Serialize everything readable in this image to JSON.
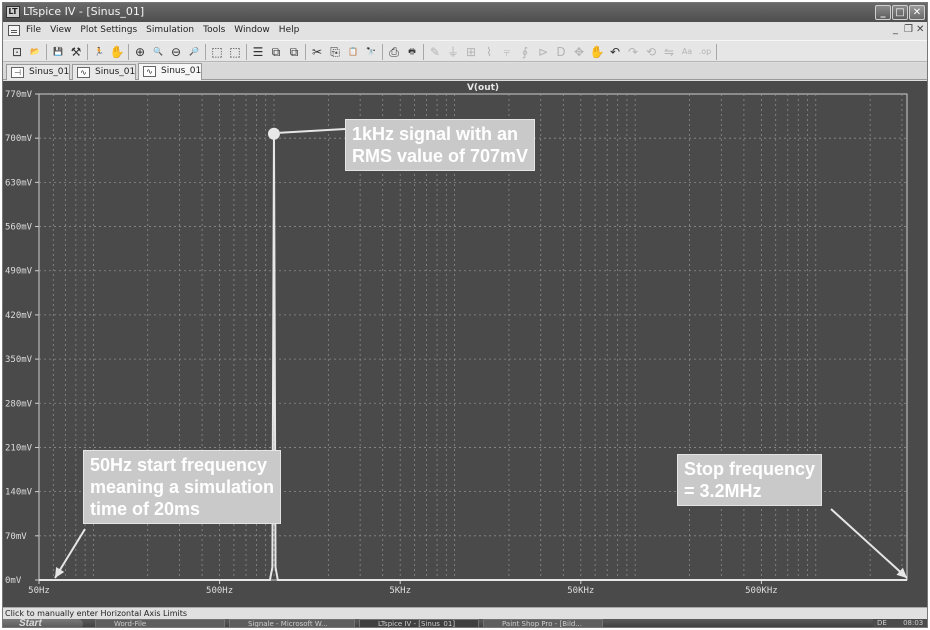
{
  "window": {
    "title": "LTspice IV - [Sinus_01]",
    "app_icon_label": "LT",
    "minimize_glyph": "_",
    "maximize_glyph": "□",
    "close_glyph": "✕",
    "mdi_minimize_glyph": "_",
    "mdi_restore_glyph": "❐",
    "mdi_close_glyph": "✕"
  },
  "menu": {
    "items": [
      "File",
      "View",
      "Plot Settings",
      "Simulation",
      "Tools",
      "Window",
      "Help"
    ]
  },
  "toolbar": {
    "icons": [
      {
        "name": "new-schematic-icon",
        "glyph": "⊡",
        "enabled": true
      },
      {
        "name": "open-file-icon",
        "glyph": "📂",
        "enabled": true
      },
      {
        "name": "save-icon",
        "glyph": "💾",
        "enabled": true
      },
      {
        "name": "control-panel-icon",
        "glyph": "⚒",
        "enabled": true
      },
      {
        "name": "run-icon",
        "glyph": "🏃",
        "enabled": false
      },
      {
        "name": "halt-icon",
        "glyph": "✋",
        "enabled": false
      },
      {
        "name": "zoom-in-icon",
        "glyph": "⊕",
        "enabled": true
      },
      {
        "name": "pan-icon",
        "glyph": "🔍",
        "enabled": true
      },
      {
        "name": "zoom-out-icon",
        "glyph": "⊖",
        "enabled": true
      },
      {
        "name": "zoom-fit-icon",
        "glyph": "🔎",
        "enabled": true
      },
      {
        "name": "autorange-icon",
        "glyph": "⬚",
        "enabled": true
      },
      {
        "name": "plot-settings-icon",
        "glyph": "⬚",
        "enabled": true
      },
      {
        "name": "tile-horizontal-icon",
        "glyph": "☰",
        "enabled": true
      },
      {
        "name": "tile-vertical-icon",
        "glyph": "⧉",
        "enabled": true
      },
      {
        "name": "cascade-icon",
        "glyph": "⧉",
        "enabled": true
      },
      {
        "name": "cut-icon",
        "glyph": "✂",
        "enabled": true
      },
      {
        "name": "copy-icon",
        "glyph": "⎘",
        "enabled": true
      },
      {
        "name": "paste-icon",
        "glyph": "📋",
        "enabled": true
      },
      {
        "name": "find-icon",
        "glyph": "🔭",
        "enabled": true
      },
      {
        "name": "print-preview-icon",
        "glyph": "⎙",
        "enabled": true
      },
      {
        "name": "print-icon",
        "glyph": "🖶",
        "enabled": true
      },
      {
        "name": "wire-icon",
        "glyph": "✎",
        "enabled": false
      },
      {
        "name": "ground-icon",
        "glyph": "⏚",
        "enabled": false
      },
      {
        "name": "label-net-icon",
        "glyph": "⊞",
        "enabled": false
      },
      {
        "name": "resistor-icon",
        "glyph": "⌇",
        "enabled": false
      },
      {
        "name": "capacitor-icon",
        "glyph": "⫧",
        "enabled": false
      },
      {
        "name": "inductor-icon",
        "glyph": "∮",
        "enabled": false
      },
      {
        "name": "diode-icon",
        "glyph": "⊳",
        "enabled": false
      },
      {
        "name": "component-icon",
        "glyph": "D",
        "enabled": false
      },
      {
        "name": "move-icon",
        "glyph": "✥",
        "enabled": false
      },
      {
        "name": "drag-icon",
        "glyph": "✋",
        "enabled": false
      },
      {
        "name": "undo-icon",
        "glyph": "↶",
        "enabled": true
      },
      {
        "name": "redo-icon",
        "glyph": "↷",
        "enabled": false
      },
      {
        "name": "rotate-icon",
        "glyph": "⟲",
        "enabled": false
      },
      {
        "name": "mirror-icon",
        "glyph": "⇋",
        "enabled": false
      },
      {
        "name": "text-icon",
        "glyph": "Aa",
        "enabled": false
      },
      {
        "name": "spice-directive-icon",
        "glyph": ".op",
        "enabled": false
      }
    ]
  },
  "tabs": [
    {
      "label": "Sinus_01",
      "kind": "schematic"
    },
    {
      "label": "Sinus_01",
      "kind": "waveform"
    },
    {
      "label": "Sinus_01",
      "kind": "waveform"
    }
  ],
  "plot": {
    "trace_label": "V(out)"
  },
  "annotations": {
    "peak": [
      "1kHz signal with an",
      "RMS value of 707mV"
    ],
    "start": [
      "50Hz start frequency",
      "meaning a simulation",
      "time of 20ms"
    ],
    "stop": [
      "Stop frequency",
      "= 3.2MHz"
    ]
  },
  "chart_data": {
    "type": "line",
    "x_scale": "log",
    "xlim": [
      50,
      3200000
    ],
    "ylim": [
      0,
      0.77
    ],
    "x_ticks": [
      {
        "value": 50,
        "label": "50Hz"
      },
      {
        "value": 500,
        "label": "500Hz"
      },
      {
        "value": 5000,
        "label": "5KHz"
      },
      {
        "value": 50000,
        "label": "50KHz"
      },
      {
        "value": 500000,
        "label": "500KHz"
      }
    ],
    "y_ticks": [
      {
        "value": 0,
        "label": "0mV"
      },
      {
        "value": 0.07,
        "label": "70mV"
      },
      {
        "value": 0.14,
        "label": "140mV"
      },
      {
        "value": 0.21,
        "label": "210mV"
      },
      {
        "value": 0.28,
        "label": "280mV"
      },
      {
        "value": 0.35,
        "label": "350mV"
      },
      {
        "value": 0.42,
        "label": "420mV"
      },
      {
        "value": 0.49,
        "label": "490mV"
      },
      {
        "value": 0.56,
        "label": "560mV"
      },
      {
        "value": 0.63,
        "label": "630mV"
      },
      {
        "value": 0.7,
        "label": "700mV"
      },
      {
        "value": 0.77,
        "label": "770mV"
      }
    ],
    "grid": true,
    "series": [
      {
        "name": "V(out)",
        "color": "#e6e6e6",
        "x": [
          50,
          950,
          980,
          1000,
          1020,
          1050,
          3200000
        ],
        "y": [
          0,
          0,
          0.02,
          0.707,
          0.02,
          0,
          0
        ]
      }
    ],
    "peak_marker": {
      "x": 1000,
      "y": 0.707
    }
  },
  "colors": {
    "plot_background": "#4a4a4a",
    "grid": "#8c8c8c",
    "axis": "#cfcfcf",
    "trace": "#e6e6e6",
    "callout_background": "#c9c9c9",
    "callout_text": "#ffffff",
    "pointer": "#e6e6e6"
  },
  "status": {
    "text": "Click to manually enter Horizontal Axis Limits"
  },
  "taskbar": {
    "start_label": "Start",
    "tasks": [
      {
        "label": "Word-File",
        "active": false
      },
      {
        "label": "Signale - Microsoft W...",
        "active": false
      },
      {
        "label": "LTspice IV - [Sinus_01]",
        "active": true
      },
      {
        "label": "Paint Shop Pro - [Bild...",
        "active": false
      }
    ],
    "language": "DE",
    "clock": "08:03"
  }
}
